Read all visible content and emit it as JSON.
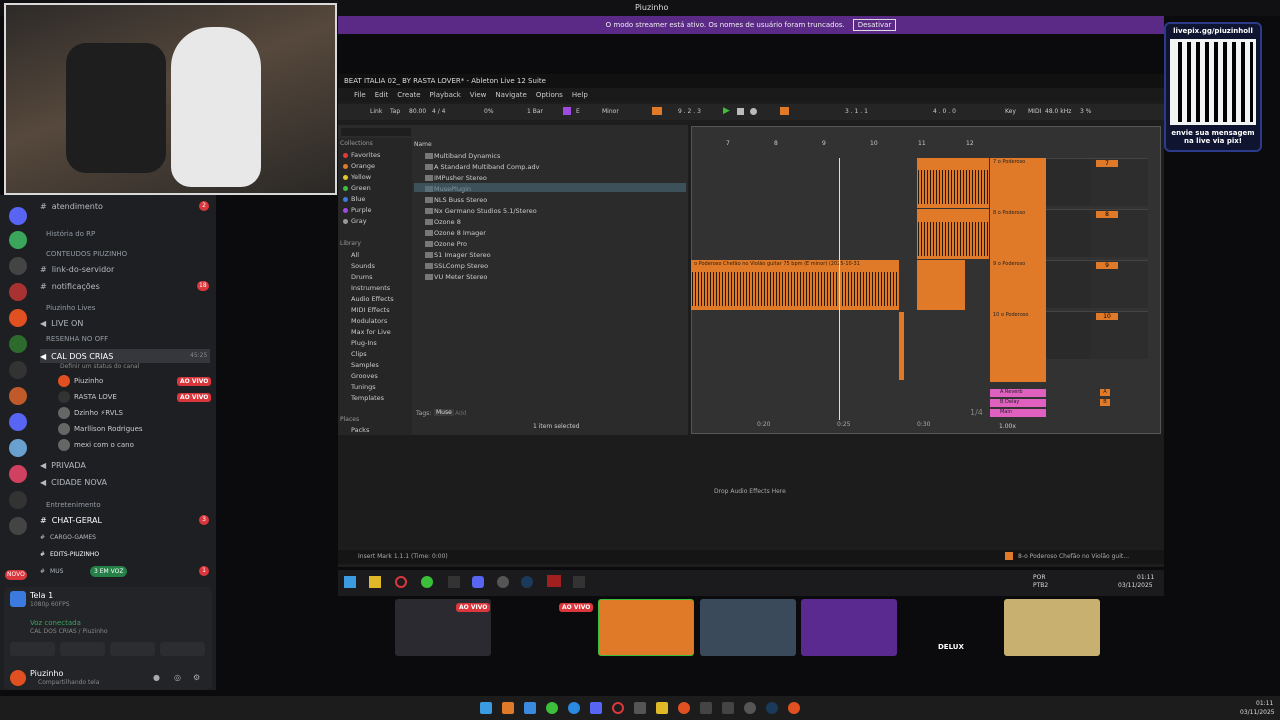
{
  "window": {
    "app_title": "Piuzinho"
  },
  "banner": {
    "text": "O modo streamer está ativo. Os nomes de usuário foram truncados.",
    "button": "Desativar"
  },
  "qr": {
    "url": "livepix.gg/piuzinholl",
    "caption": "envie sua mensagem na live via pix!"
  },
  "discord": {
    "channels": [
      {
        "icon": "#",
        "label": "atendimento",
        "badge": "2"
      },
      {
        "cat": "História do RP"
      },
      {
        "cat": "CONTEUDOS PIUZINHO"
      },
      {
        "icon": "#",
        "label": "link-do-servidor"
      },
      {
        "icon": "#",
        "label": "notificações",
        "badge": "18"
      },
      {
        "cat": "Piuzinho Lives"
      },
      {
        "icon": "speaker",
        "label": "LIVE ON"
      },
      {
        "cat": "RESENHA NO OFF"
      },
      {
        "icon": "speaker",
        "label": "CAL DOS CRIAS",
        "time": "45:25"
      }
    ],
    "status_hint": "Definir um status do canal",
    "voice_users": [
      {
        "name": "Piuzinho",
        "live": "AO VIVO"
      },
      {
        "name": "RASTA LOVE",
        "live": "AO VIVO"
      },
      {
        "name": "Dzinho ⚡RVLS"
      },
      {
        "name": "Marllison Rodrigues"
      },
      {
        "name": "mexi com o cano"
      }
    ],
    "more_channels": [
      {
        "icon": "speaker",
        "label": "PRIVADA"
      },
      {
        "icon": "speaker",
        "label": "CIDADE NOVA"
      },
      {
        "cat": "Entretenimento"
      },
      {
        "icon": "#",
        "label": "CHAT-GERAL",
        "badge": "3"
      },
      {
        "icon": "#",
        "label": "CARGO-GAMES"
      },
      {
        "icon": "#",
        "label": "EDITS-PIUZINHO"
      },
      {
        "icon": "#",
        "label": "MUS",
        "badge": "1"
      }
    ],
    "in_voice_pill": "3 EM VOZ",
    "screen_share": {
      "title": "Tela 1",
      "subtitle": "1080p 60FPS"
    },
    "voice": {
      "status": "Voz conectada",
      "channel": "CAL DOS CRIAS / Piuzinho"
    },
    "user": {
      "name": "Piuzinho",
      "status": "Compartilhando tela"
    },
    "new_badge": "NOVO"
  },
  "ableton": {
    "title": "BEAT ITALIA 02_ BY RASTA LOVER* - Ableton Live 12 Suite",
    "menu": [
      "File",
      "Edit",
      "Create",
      "Playback",
      "View",
      "Navigate",
      "Options",
      "Help"
    ],
    "toolbar": {
      "link": "Link",
      "tap": "Tap",
      "bpm": "80.00",
      "sig": "4 / 4",
      "pct": "0%",
      "bar": "1 Bar",
      "key": "E",
      "scale": "Minor",
      "pos": "9 . 2 . 3",
      "pos2": "3 . 1 . 1",
      "len": "4 . 0 . 0",
      "keylbl": "Key",
      "midi": "MIDI",
      "rate": "48.0 kHz",
      "cpu": "3 %"
    },
    "collections_title": "Collections",
    "collections": [
      {
        "label": "Favorites",
        "color": "#e03b3b"
      },
      {
        "label": "Orange",
        "color": "#e07a28"
      },
      {
        "label": "Yellow",
        "color": "#e0c828"
      },
      {
        "label": "Green",
        "color": "#3cc03c"
      },
      {
        "label": "Blue",
        "color": "#3b7be0"
      },
      {
        "label": "Purple",
        "color": "#a04be0"
      },
      {
        "label": "Gray",
        "color": "#999999"
      }
    ],
    "library_title": "Library",
    "library": [
      "All",
      "Sounds",
      "Drums",
      "Instruments",
      "Audio Effects",
      "MIDI Effects",
      "Modulators",
      "Max for Live",
      "Plug-Ins",
      "Clips",
      "Samples",
      "Grooves",
      "Tunings",
      "Templates"
    ],
    "places_title": "Places",
    "places": [
      "Packs"
    ],
    "name_header": "Name",
    "files": [
      "Multiband Dynamics",
      "A Standard Multiband Comp.adv",
      "IMPusher Stereo",
      "MusePlugin",
      "NLS Buss Stereo",
      "Nx Germano Studios 5.1/Stereo",
      "Ozone 8",
      "Ozone 8 Imager",
      "Ozone Pro",
      "S1 Imager Stereo",
      "SSLComp Stereo",
      "VU Meter Stereo"
    ],
    "tags_label": "Tags:",
    "tag": "Muse",
    "add": "Add",
    "selected": "1 item selected",
    "ruler": [
      "7",
      "8",
      "9",
      "10",
      "11",
      "12"
    ],
    "time_marks": [
      "0:20",
      "0:25",
      "0:30"
    ],
    "tracks": [
      {
        "num": "7",
        "name": "7 o Poderoso"
      },
      {
        "num": "8",
        "name": "8 o Poderoso"
      },
      {
        "num": "9",
        "name": "9 o Poderoso"
      },
      {
        "num": "10",
        "name": "10 o Poderoso"
      }
    ],
    "returns": [
      {
        "letter": "A",
        "name": "A Reverb",
        "color": "#e060c0"
      },
      {
        "letter": "B",
        "name": "B Delay",
        "color": "#e060c0"
      },
      {
        "letter": "",
        "name": "Main",
        "color": "#e060c0"
      }
    ],
    "clip_label": "o Poderoso Chefão no Violão guitar 75 bpm (E minor) (2025-10-31",
    "drop_text": "Drop Audio Effects Here",
    "status": "Insert Mark 1.1.1 (Time: 0:00)",
    "status_right": "8-o Poderoso Chefão no Violão guit...",
    "fraction": "1/4",
    "zoom": "1.00x"
  },
  "tray": {
    "lang1": "POR",
    "lang2": "PTB2",
    "time": "01:11",
    "date": "03/11/2025"
  },
  "thumb_labels": [
    "AO VIVO",
    "AO VIVO"
  ],
  "delux": "DELUX",
  "taskbar_time": "01:11",
  "taskbar_date": "03/11/2025"
}
